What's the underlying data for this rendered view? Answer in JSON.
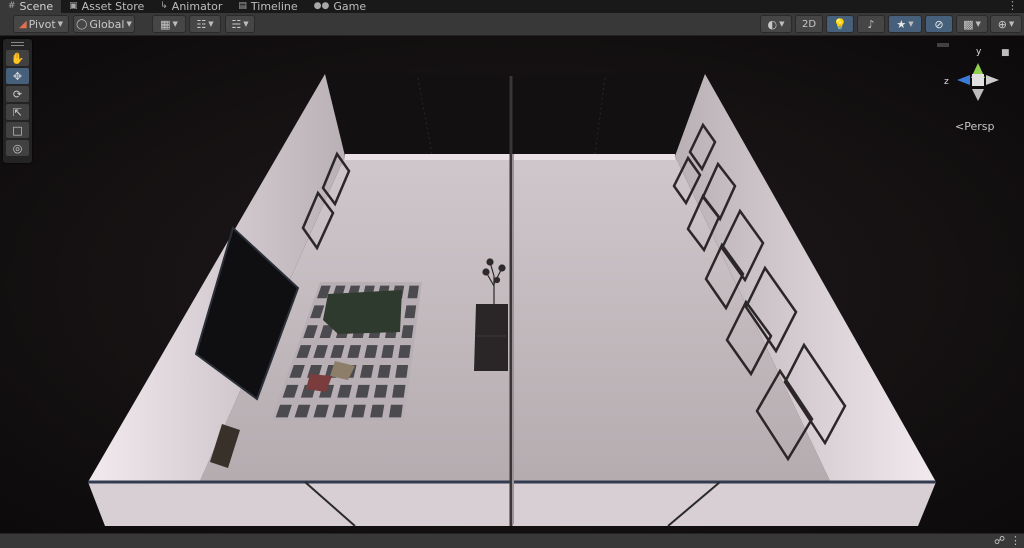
{
  "tabs": [
    {
      "label": "Scene",
      "icon": "grid-icon",
      "active": true
    },
    {
      "label": "Asset Store",
      "icon": "bag-icon",
      "active": false
    },
    {
      "label": "Animator",
      "icon": "animator-icon",
      "active": false
    },
    {
      "label": "Timeline",
      "icon": "timeline-icon",
      "active": false
    },
    {
      "label": "Game",
      "icon": "gamepad-icon",
      "active": false
    }
  ],
  "toolbar": {
    "pivot_label": "Pivot",
    "global_label": "Global",
    "two_d_label": "2D"
  },
  "tools": [
    "hand-tool",
    "move-tool",
    "rotate-tool",
    "scale-tool",
    "rect-tool",
    "transform-tool"
  ],
  "gizmo": {
    "y_label": "y",
    "z_label": "z",
    "projection_label": "Persp"
  },
  "colors": {
    "accent": "#46607c",
    "wall": "#d8cfd2",
    "floor": "#cbc2c6",
    "gizmo_y": "#8fd14f",
    "gizmo_z": "#3b7bd8"
  }
}
